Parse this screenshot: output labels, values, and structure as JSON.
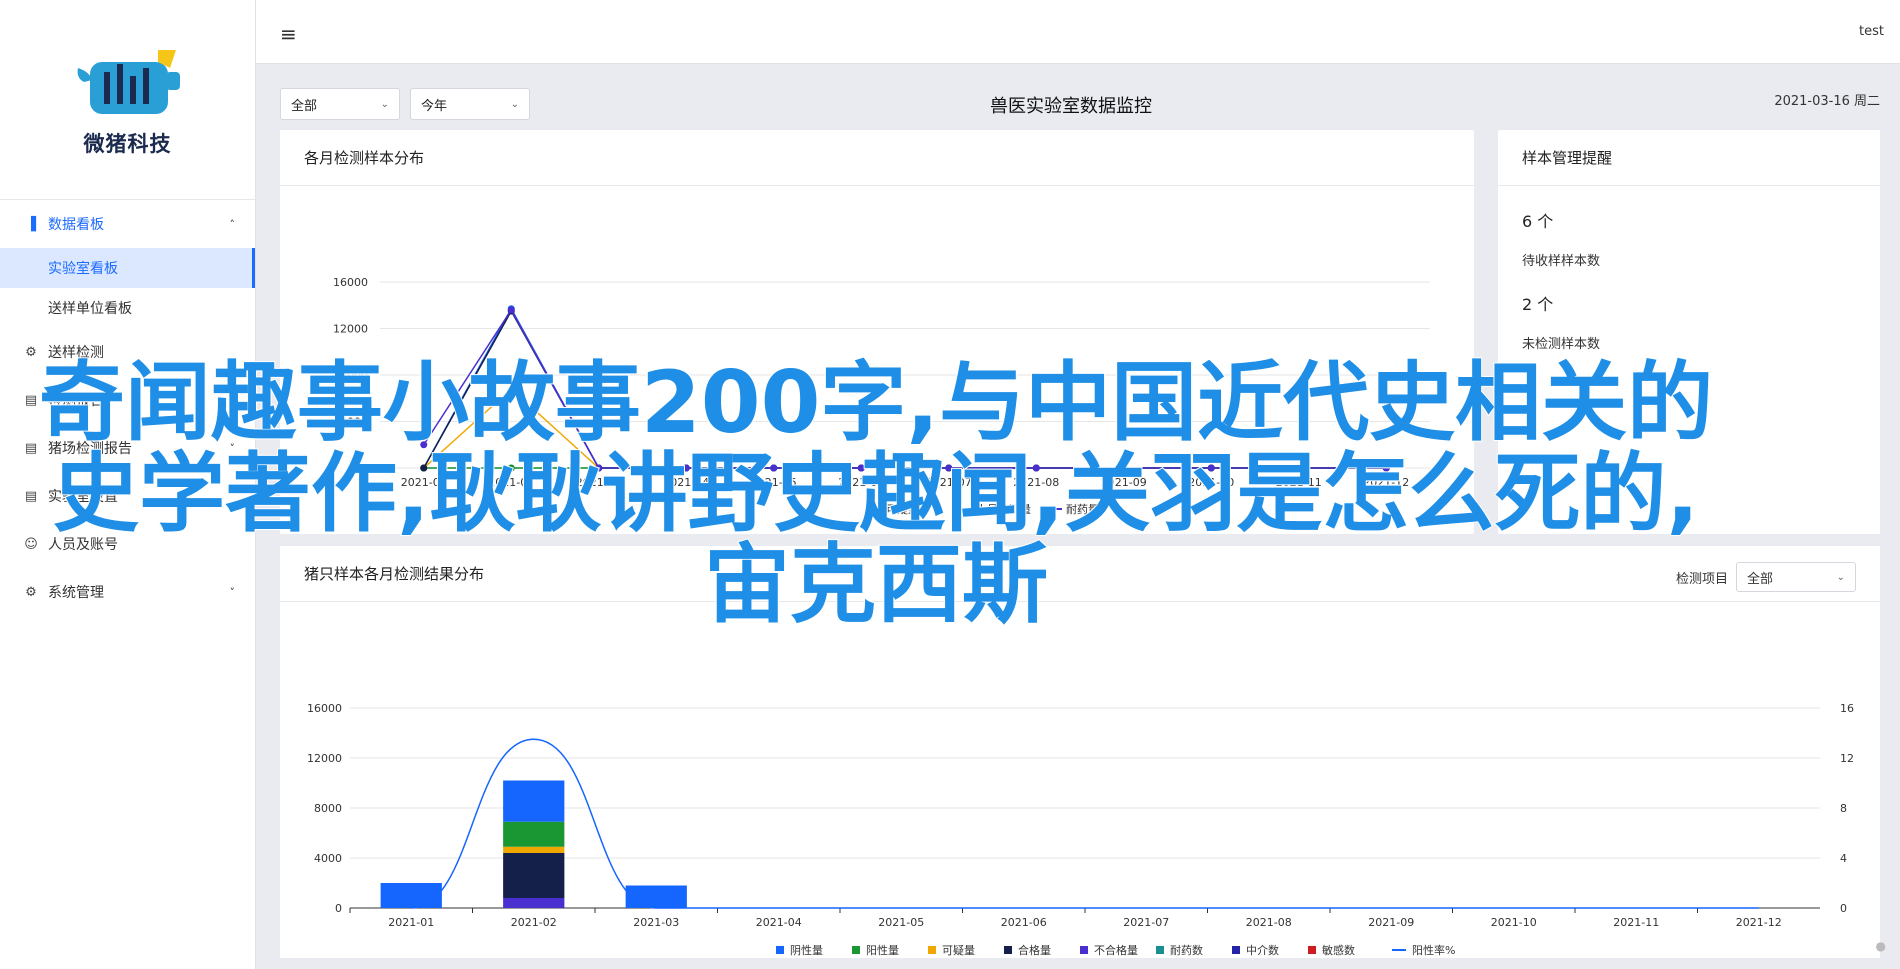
{
  "brand": {
    "name": "微猪科技"
  },
  "sidebar": {
    "items": [
      {
        "label": "数据看板",
        "icon": "bar-chart-icon",
        "expanded": true,
        "children": [
          "实验室看板",
          "送样单位看板"
        ]
      },
      {
        "label": "送样检测",
        "icon": "sample-icon"
      },
      {
        "label": "检测报告",
        "icon": "report-icon"
      },
      {
        "label": "猪场检测报告",
        "icon": "document-icon"
      },
      {
        "label": "实验室设置",
        "icon": "document-icon"
      },
      {
        "label": "人员及账号",
        "icon": "user-icon"
      },
      {
        "label": "系统管理",
        "icon": "gear-icon"
      }
    ]
  },
  "topbar": {
    "user": "test"
  },
  "filters": {
    "scope": "全部",
    "period": "今年"
  },
  "page": {
    "title": "兽医实验室数据监控",
    "date": "2021-03-16 周二"
  },
  "card1": {
    "title": "各月检测样本分布"
  },
  "card2": {
    "title": "样本管理提醒",
    "stats": [
      {
        "value": "6 个",
        "label": "待收样样本数"
      },
      {
        "value": "2 个",
        "label": "未检测样本数"
      }
    ]
  },
  "card3": {
    "title": "猪只样本各月检测结果分布",
    "filter_label": "检测项目",
    "filter_value": "全部"
  },
  "overlay": {
    "title": "奇闻趣事小故事200字,与中国近代史相关的史学著作,耿耿讲野史趣闻,关羽是怎么死的,宙克西斯"
  },
  "colors": {
    "accent": "#1c6bff",
    "overlay": "#1e8ee6"
  },
  "chart_data": [
    {
      "type": "line",
      "title": "各月检测样本分布",
      "categories": [
        "2021-01",
        "2021-02",
        "2021-03",
        "2021-04",
        "2021-05",
        "2021-06",
        "2021-07",
        "2021-08",
        "2021-09",
        "2021-10",
        "2021-11",
        "2021-12"
      ],
      "ylim": [
        0,
        16000
      ],
      "yticks": [
        0,
        4000,
        8000,
        12000,
        16000
      ],
      "series": [
        {
          "name": "阳性量",
          "color": "#1565ff",
          "values": [
            0,
            13700,
            0,
            0,
            0,
            0,
            0,
            0,
            0,
            0,
            0,
            0
          ]
        },
        {
          "name": "可疑量",
          "color": "#f0a800",
          "values": [
            0,
            6800,
            0,
            0,
            0,
            0,
            0,
            0,
            0,
            0,
            0,
            0
          ]
        },
        {
          "name": "合格量",
          "color": "#0f8c2c",
          "values": [
            0,
            0,
            0,
            0,
            0,
            0,
            0,
            0,
            0,
            0,
            0,
            0
          ]
        },
        {
          "name": "人员检测量",
          "color": "#14204a",
          "values": [
            0,
            13500,
            0,
            0,
            0,
            0,
            0,
            0,
            0,
            0,
            0,
            0
          ]
        },
        {
          "name": "耐药量",
          "color": "#4a2fd0",
          "values": [
            2000,
            13600,
            0,
            0,
            0,
            0,
            0,
            0,
            0,
            0,
            0,
            0
          ]
        }
      ],
      "legend": [
        "可疑量",
        "人员检测量",
        "耐药量"
      ],
      "legend_colors": [
        "#f0a800",
        "#14204a",
        "#4a2fd0"
      ]
    },
    {
      "type": "bar",
      "title": "猪只样本各月检测结果分布",
      "categories": [
        "2021-01",
        "2021-02",
        "2021-03",
        "2021-04",
        "2021-05",
        "2021-06",
        "2021-07",
        "2021-08",
        "2021-09",
        "2021-10",
        "2021-11",
        "2021-12"
      ],
      "ylim": [
        0,
        16000
      ],
      "yticks": [
        0,
        4000,
        8000,
        12000,
        16000
      ],
      "y2lim": [
        0,
        16
      ],
      "y2ticks": [
        0,
        4,
        8,
        12,
        16
      ],
      "stacked": true,
      "series": [
        {
          "name": "阴性量",
          "color": "#1565ff",
          "values": [
            2000,
            3300,
            1800,
            0,
            0,
            0,
            0,
            0,
            0,
            0,
            0,
            0
          ]
        },
        {
          "name": "阳性量",
          "color": "#1a9632",
          "values": [
            0,
            2000,
            0,
            0,
            0,
            0,
            0,
            0,
            0,
            0,
            0,
            0
          ]
        },
        {
          "name": "可疑量",
          "color": "#f0a800",
          "values": [
            0,
            500,
            0,
            0,
            0,
            0,
            0,
            0,
            0,
            0,
            0,
            0
          ]
        },
        {
          "name": "合格量",
          "color": "#14204a",
          "values": [
            0,
            3600,
            0,
            0,
            0,
            0,
            0,
            0,
            0,
            0,
            0,
            0
          ]
        },
        {
          "name": "不合格量",
          "color": "#4a2fd0",
          "values": [
            0,
            800,
            0,
            0,
            0,
            0,
            0,
            0,
            0,
            0,
            0,
            0
          ]
        },
        {
          "name": "耐药数",
          "color": "#1a8f8f",
          "values": [
            0,
            0,
            0,
            0,
            0,
            0,
            0,
            0,
            0,
            0,
            0,
            0
          ]
        },
        {
          "name": "中介数",
          "color": "#2424a8",
          "values": [
            0,
            0,
            0,
            0,
            0,
            0,
            0,
            0,
            0,
            0,
            0,
            0
          ]
        },
        {
          "name": "敏感数",
          "color": "#d01c1c",
          "values": [
            0,
            0,
            0,
            0,
            0,
            0,
            0,
            0,
            0,
            0,
            0,
            0
          ]
        }
      ],
      "line_series": {
        "name": "阳性率%",
        "color": "#1565ff",
        "values": [
          0,
          13.5,
          0,
          0,
          0,
          0,
          0,
          0,
          0,
          0,
          0,
          0
        ]
      }
    }
  ]
}
